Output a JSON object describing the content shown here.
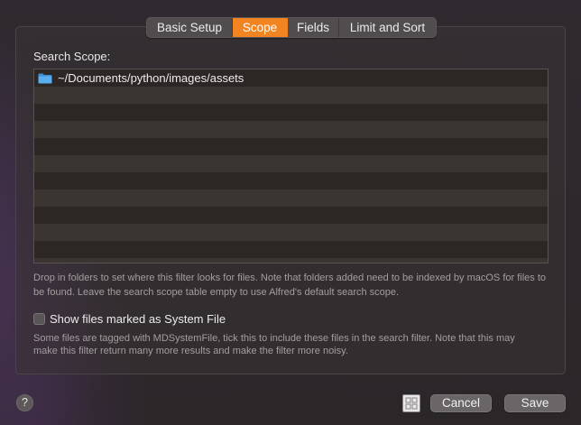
{
  "tabs": [
    {
      "label": "Basic Setup",
      "selected": false
    },
    {
      "label": "Scope",
      "selected": true
    },
    {
      "label": "Fields",
      "selected": false
    },
    {
      "label": "Limit and Sort",
      "selected": false
    }
  ],
  "scope": {
    "label": "Search Scope:",
    "entries": [
      {
        "icon": "folder-icon",
        "path": "~/Documents/python/images/assets"
      }
    ],
    "help": "Drop in folders to set where this filter looks for files. Note that folders added need to be indexed by macOS for files to be found. Leave the search scope table empty to use Alfred's default search scope."
  },
  "system_file": {
    "label": "Show files marked as System File",
    "checked": false,
    "help": "Some files are tagged with MDSystemFile, tick this to include these files in the search filter. Note that this may make this filter return many more results and make the filter more noisy."
  },
  "footer": {
    "help_label": "?",
    "grid_icon": "grid-icon",
    "cancel_label": "Cancel",
    "save_label": "Save"
  },
  "colors": {
    "accent": "#f28522",
    "folder": "#4a9ee0"
  }
}
